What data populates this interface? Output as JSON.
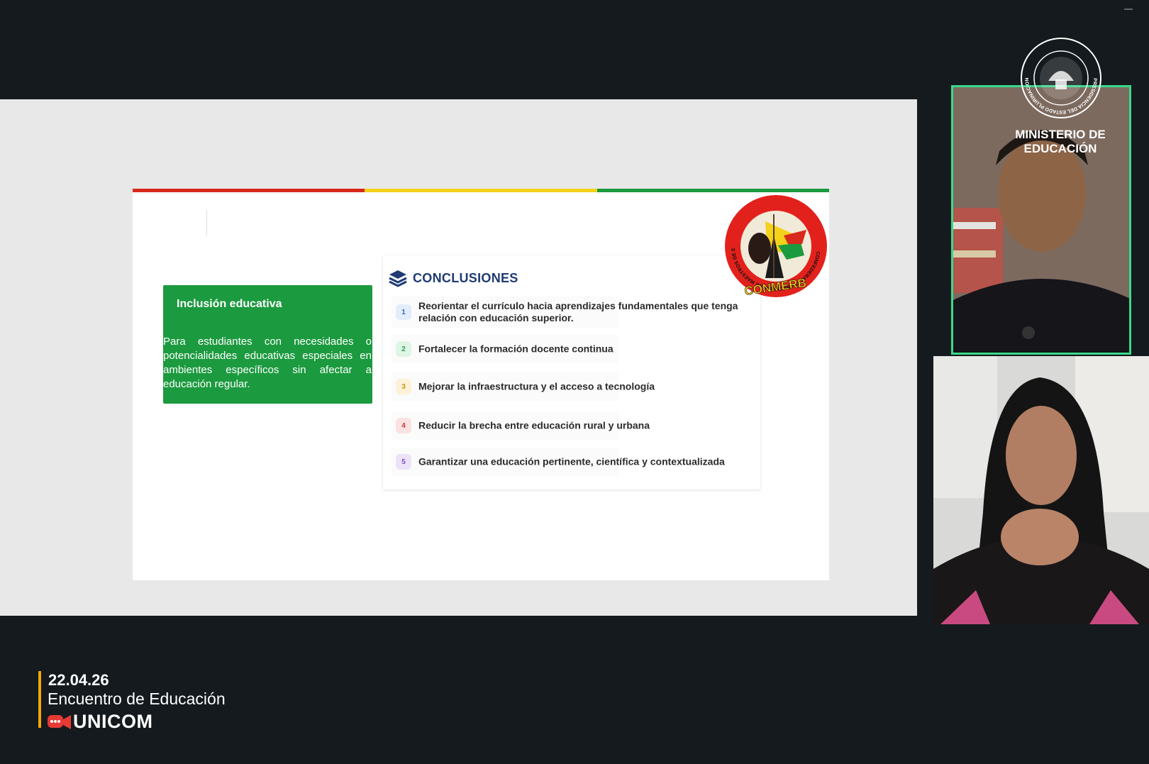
{
  "colors": {
    "background": "#141a1d",
    "accent_green": "#39d98a",
    "flag": [
      "#d8291c",
      "#f4d11a",
      "#1c9a3f"
    ],
    "card_green": "#1c9a3f",
    "event_accent": "#f2a60c",
    "brand_red": "#e63a35"
  },
  "slide": {
    "card": {
      "title": "Inclusión educativa",
      "body": "Para estudiantes con necesidades o potencialidades educativas especiales en ambientes específicos sin afectar a educación regular."
    },
    "conclusions": {
      "title": "CONCLUSIONES",
      "icon": "layers-icon",
      "items": [
        {
          "num": "1",
          "text": "Reorientar el currículo hacia aprendizajes fundamentales que tenga relación con educación superior.",
          "badge_bg": "#e3ecfb",
          "badge_fg": "#3a63c9"
        },
        {
          "num": "2",
          "text": "Fortalecer la formación docente continua",
          "badge_bg": "#dff5e6",
          "badge_fg": "#2e9a55"
        },
        {
          "num": "3",
          "text": "Mejorar la infraestructura y el acceso a tecnología",
          "badge_bg": "#fdf2d8",
          "badge_fg": "#c99014"
        },
        {
          "num": "4",
          "text": "Reducir la brecha entre educación rural y urbana",
          "badge_bg": "#fbe1e1",
          "badge_fg": "#c93a3a"
        },
        {
          "num": "5",
          "text": "Garantizar una educación pertinente, científica y contextualizada",
          "badge_bg": "#ece3f9",
          "badge_fg": "#7a4cc2"
        }
      ]
    },
    "logo": {
      "text": "CONMERB",
      "ring_text": "CONFEDERACIÓN NACIONAL DE MAESTROS DE EDUCACIÓN RURAL DE BOLIVIA"
    }
  },
  "overlay": {
    "seal_text": "PRESIDENCIA DEL ESTADO PLURINACIONAL DE BOLIVIA",
    "ministry_line1": "MINISTERIO DE",
    "ministry_line2": "EDUCACIÓN"
  },
  "event": {
    "date": "22.04.26",
    "title": "Encuentro de Educación",
    "brand": "UNICOM"
  }
}
